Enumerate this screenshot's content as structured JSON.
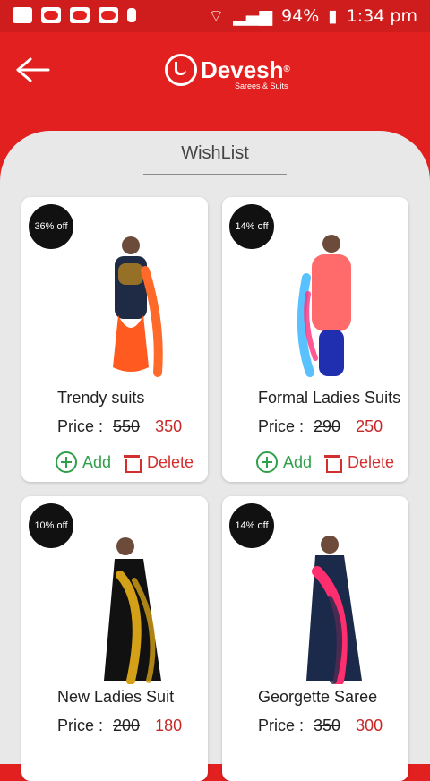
{
  "status_bar": {
    "battery": "94%",
    "time": "1:34 pm"
  },
  "header": {
    "brand_name": "Devesh",
    "brand_tagline": "Sarees & Suits"
  },
  "wishlist": {
    "title": "WishList",
    "items": [
      {
        "discount": "36% off",
        "name": "Trendy suits",
        "price_label": "Price :",
        "old_price": "550",
        "new_price": "350",
        "add_label": "Add",
        "delete_label": "Delete"
      },
      {
        "discount": "14% off",
        "name": "Formal Ladies Suits",
        "price_label": "Price :",
        "old_price": "290",
        "new_price": "250",
        "add_label": "Add",
        "delete_label": "Delete"
      },
      {
        "discount": "10% off",
        "name": "New Ladies Suit",
        "price_label": "Price :",
        "old_price": "200",
        "new_price": "180"
      },
      {
        "discount": "14% off",
        "name": "Georgette Saree",
        "price_label": "Price :",
        "old_price": "350",
        "new_price": "300"
      }
    ]
  },
  "colors": {
    "brand_red": "#e2201f",
    "add_green": "#2f9f4a",
    "delete_red": "#d32f2f"
  }
}
